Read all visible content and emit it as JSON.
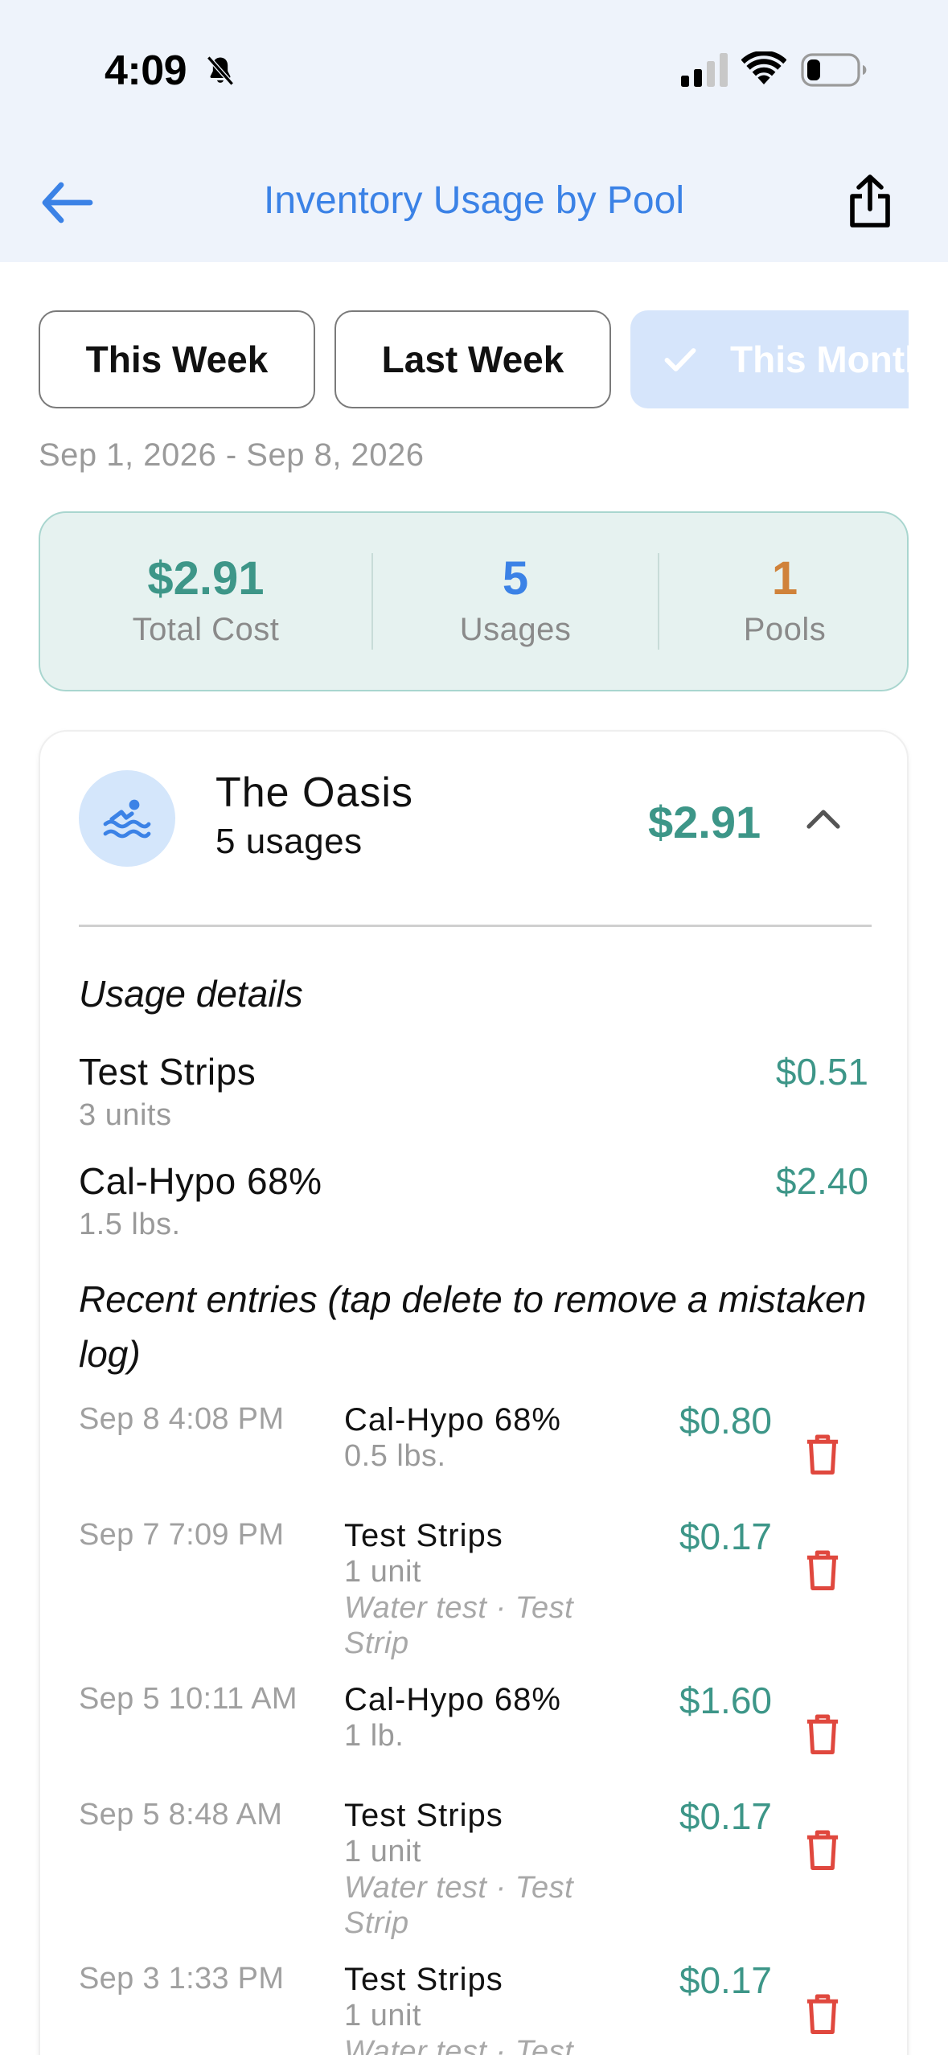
{
  "status_bar": {
    "time": "4:09",
    "icons": [
      "bell-slash-icon",
      "signal-icon",
      "wifi-icon",
      "battery-icon"
    ]
  },
  "nav": {
    "title": "Inventory Usage by Pool",
    "back_icon": "arrow-left-icon",
    "share_icon": "share-icon"
  },
  "filters": {
    "chips": [
      {
        "label": "This Week",
        "selected": false
      },
      {
        "label": "Last Week",
        "selected": false
      },
      {
        "label": "This Month",
        "selected": true
      }
    ]
  },
  "date_range": "Sep 1, 2026 - Sep 8, 2026",
  "summary": {
    "total_cost": {
      "value": "$2.91",
      "label": "Total Cost"
    },
    "usages": {
      "value": "5",
      "label": "Usages"
    },
    "pools": {
      "value": "1",
      "label": "Pools"
    }
  },
  "pool": {
    "name": "The Oasis",
    "usage_count": "5 usages",
    "total": "$2.91",
    "icon": "swimmer-icon",
    "usage_details_title": "Usage details",
    "usage_details": [
      {
        "name": "Test Strips",
        "qty": "3 units",
        "cost": "$0.51"
      },
      {
        "name": "Cal-Hypo 68%",
        "qty": "1.5 lbs.",
        "cost": "$2.40"
      }
    ],
    "recent_title": "Recent entries (tap delete to remove a mistaken log)",
    "entries": [
      {
        "date": "Sep 8 4:08 PM",
        "item": "Cal-Hypo 68%",
        "qty": "0.5 lbs.",
        "note": "",
        "cost": "$0.80"
      },
      {
        "date": "Sep 7 7:09 PM",
        "item": "Test Strips",
        "qty": "1 unit",
        "note": "Water test · Test Strip",
        "cost": "$0.17"
      },
      {
        "date": "Sep 5 10:11 AM",
        "item": "Cal-Hypo 68%",
        "qty": "1 lb.",
        "note": "",
        "cost": "$1.60"
      },
      {
        "date": "Sep 5 8:48 AM",
        "item": "Test Strips",
        "qty": "1 unit",
        "note": "Water test · Test Strip",
        "cost": "$0.17"
      },
      {
        "date": "Sep 3 1:33 PM",
        "item": "Test Strips",
        "qty": "1 unit",
        "note": "Water test · Test Strip",
        "cost": "$0.17"
      }
    ]
  },
  "colors": {
    "accent_blue": "#3b82e6",
    "teal": "#3d9688",
    "orange": "#d0823a",
    "delete_red": "#e0483e"
  }
}
